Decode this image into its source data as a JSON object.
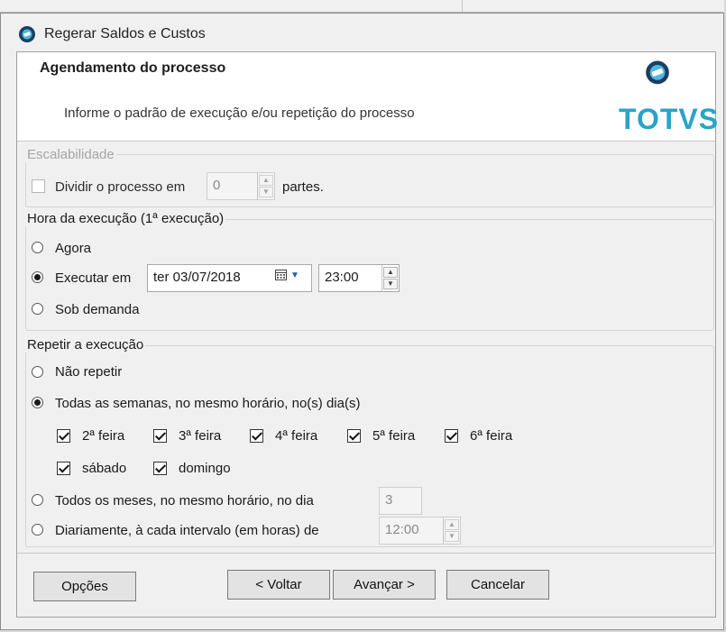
{
  "window": {
    "title": "Regerar Saldos e Custos"
  },
  "header": {
    "title": "Agendamento do processo",
    "description": "Informe o padrão de execução e/ou repetição do processo",
    "logo_text": "TOTVS",
    "logo_color": "#2aa3c9"
  },
  "scalability": {
    "legend": "Escalabilidade",
    "divide_label": "Dividir o processo em",
    "divide_checked": false,
    "parts_value": "0",
    "parts_suffix": "partes."
  },
  "execution_time": {
    "legend": "Hora da execução (1ª execução)",
    "options": [
      {
        "label": "Agora",
        "selected": false
      },
      {
        "label": "Executar em",
        "selected": true
      },
      {
        "label": "Sob demanda",
        "selected": false
      }
    ],
    "date_value": "ter  03/07/2018",
    "time_value": "23:00"
  },
  "repeat": {
    "legend": "Repetir a execução",
    "options": [
      {
        "label": "Não repetir",
        "selected": false
      },
      {
        "label": "Todas as semanas, no mesmo horário, no(s) dia(s)",
        "selected": true
      },
      {
        "label": "Todos os meses, no mesmo horário, no dia",
        "selected": false
      },
      {
        "label": "Diariamente, à cada intervalo (em horas) de",
        "selected": false
      }
    ],
    "days": [
      {
        "label": "2ª feira",
        "checked": true
      },
      {
        "label": "3ª feira",
        "checked": true
      },
      {
        "label": "4ª feira",
        "checked": true
      },
      {
        "label": "5ª feira",
        "checked": true
      },
      {
        "label": "6ª feira",
        "checked": true
      },
      {
        "label": "sábado",
        "checked": true
      },
      {
        "label": "domingo",
        "checked": true
      }
    ],
    "month_day_value": "3",
    "interval_value": "12:00"
  },
  "footer": {
    "options_label": "Opções",
    "back_label": "< Voltar",
    "next_label": "Avançar >",
    "cancel_label": "Cancelar"
  },
  "icons": {
    "app_icon": "totvs-app-icon",
    "calendar": "calendar-icon",
    "dropdown": "chevron-down-icon",
    "spin_up": "spin-up-icon",
    "spin_down": "spin-down-icon"
  }
}
